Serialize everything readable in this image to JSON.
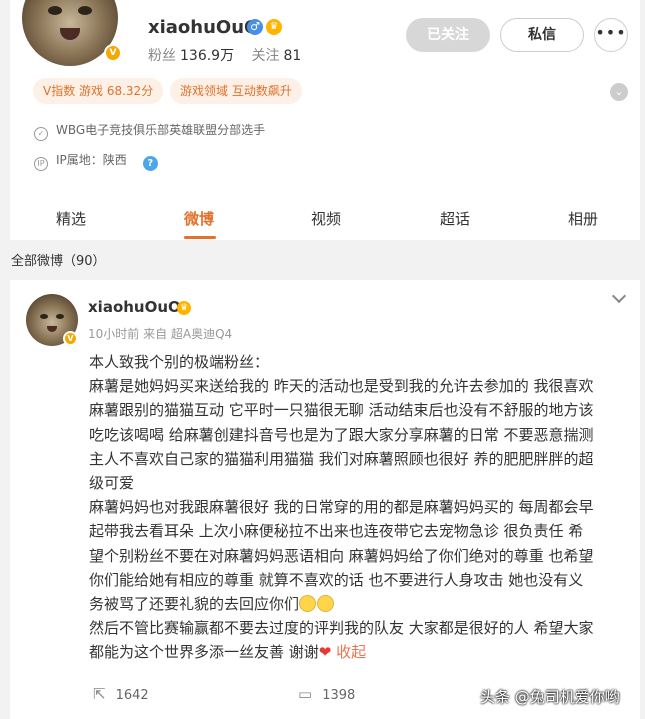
{
  "profile": {
    "username": "xiaohuOuO",
    "fans_label": "粉丝",
    "fans_count": "136.9万",
    "following_label": "关注",
    "following_count": "81",
    "btn_followed": "已关注",
    "btn_message": "私信",
    "btn_more": "•••",
    "tags": [
      "V指数 游戏 68.32分",
      "游戏领域 互动数飙升"
    ],
    "verify_text": "WBG电子竞技俱乐部英雄联盟分部选手",
    "ip_text": "IP属地：陕西",
    "badge": "V"
  },
  "tabs": [
    "精选",
    "微博",
    "视频",
    "超话",
    "相册"
  ],
  "active_tab": "微博",
  "all_weibo_label": "全部微博（90）",
  "post": {
    "username": "xiaohuOuO",
    "meta": "10小时前 来自 超A奥迪Q4",
    "lines": [
      "本人致我个别的极端粉丝：",
      "麻薯是她妈妈买来送给我的 昨天的活动也是受到我的允许去参加的 我很喜欢",
      "麻薯跟别的猫猫互动 它平时一只猫很无聊 活动结束后也没有不舒服的地方该",
      "吃吃该喝喝 给麻薯创建抖音号也是为了跟大家分享麻薯的日常 不要恶意揣测",
      "主人不喜欢自己家的猫猫利用猫猫 我们对麻薯照顾也很好 养的肥肥胖胖的超",
      "级可爱",
      "麻薯妈妈也对我跟麻薯很好 我的日常穿的用的都是麻薯妈妈买的 每周都会早",
      "起带我去看耳朵 上次小麻便秘拉不出来也连夜带它去宠物急诊 很负责任 希",
      "望个别粉丝不要在对麻薯妈妈恶语相向 麻薯妈妈给了你们绝对的尊重 也希望",
      "你们能给她有相应的尊重 就算不喜欢的话 也不要进行人身攻击 她也没有义",
      "务被骂了还要礼貌的去回应你们",
      "然后不管比赛输赢都不要去过度的评判我的队友 大家都是很好的人 希望大家",
      "都能为这个世界多添一丝友善 谢谢"
    ],
    "collapse_label": "收起",
    "repost_count": "1642",
    "comment_count": "1398"
  },
  "watermark": "头条 @兔司机爱你哟",
  "colors": {
    "accent": "#e0722d",
    "badge": "#f5a800"
  }
}
